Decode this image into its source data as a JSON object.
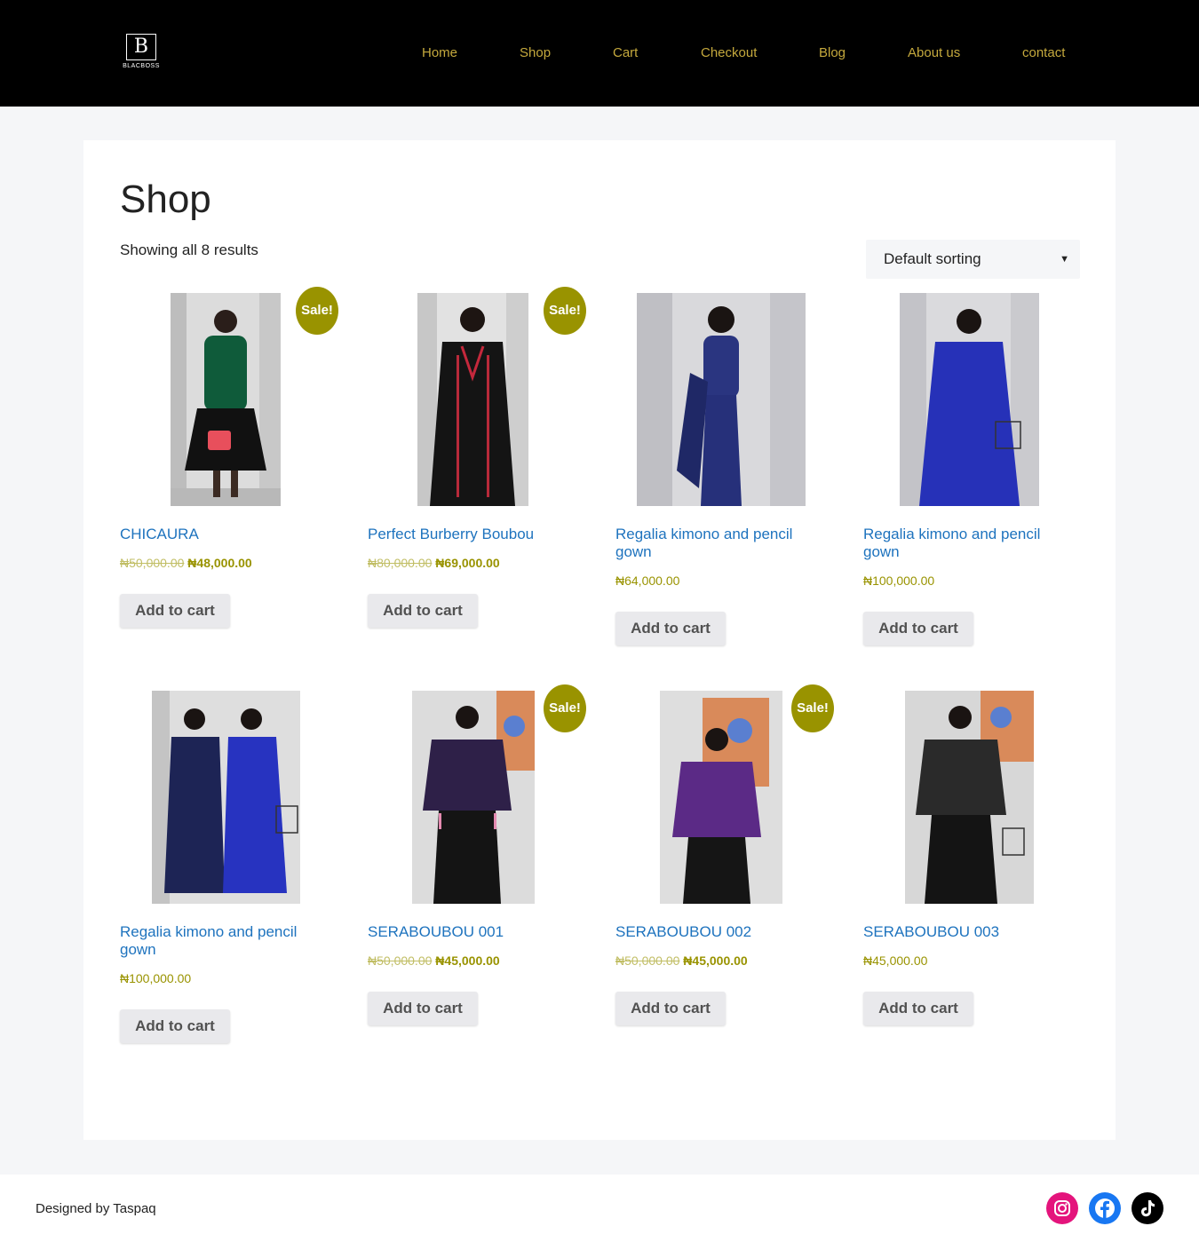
{
  "header": {
    "logo_letter": "B",
    "logo_word": "BLACBOSS",
    "nav": [
      "Home",
      "Shop",
      "Cart",
      "Checkout",
      "Blog",
      "About us",
      "contact"
    ]
  },
  "shop": {
    "title": "Shop",
    "result_count": "Showing all 8 results",
    "sort_value": "Default sorting"
  },
  "products": [
    {
      "name": "CHICAURA",
      "sale": "Sale!",
      "old_price": "₦50,000.00",
      "price": "₦48,000.00",
      "button": "Add to cart"
    },
    {
      "name": "Perfect Burberry Boubou",
      "sale": "Sale!",
      "old_price": "₦80,000.00",
      "price": "₦69,000.00",
      "button": "Add to cart"
    },
    {
      "name": "Regalia kimono and pencil gown",
      "price": "₦64,000.00",
      "button": "Add to cart"
    },
    {
      "name": "Regalia kimono and pencil gown",
      "price": "₦100,000.00",
      "button": "Add to cart"
    },
    {
      "name": "Regalia kimono and pencil gown",
      "price": "₦100,000.00",
      "button": "Add to cart"
    },
    {
      "name": "SERABOUBOU 001",
      "sale": "Sale!",
      "old_price": "₦50,000.00",
      "price": "₦45,000.00",
      "button": "Add to cart"
    },
    {
      "name": "SERABOUBOU 002",
      "sale": "Sale!",
      "old_price": "₦50,000.00",
      "price": "₦45,000.00",
      "button": "Add to cart"
    },
    {
      "name": "SERABOUBOU 003",
      "price": "₦45,000.00",
      "button": "Add to cart"
    }
  ],
  "footer": {
    "credit": "Designed by Taspaq",
    "social_icons": [
      "instagram-icon",
      "facebook-icon",
      "tiktok-icon"
    ]
  },
  "colors": {
    "header_bg": "#000000",
    "nav_text": "#c5a93d",
    "sale_badge": "#999300",
    "price": "#999300",
    "product_link": "#1e73be",
    "instagram": "#e4147c",
    "facebook": "#1877f2",
    "tiktok": "#000000"
  }
}
